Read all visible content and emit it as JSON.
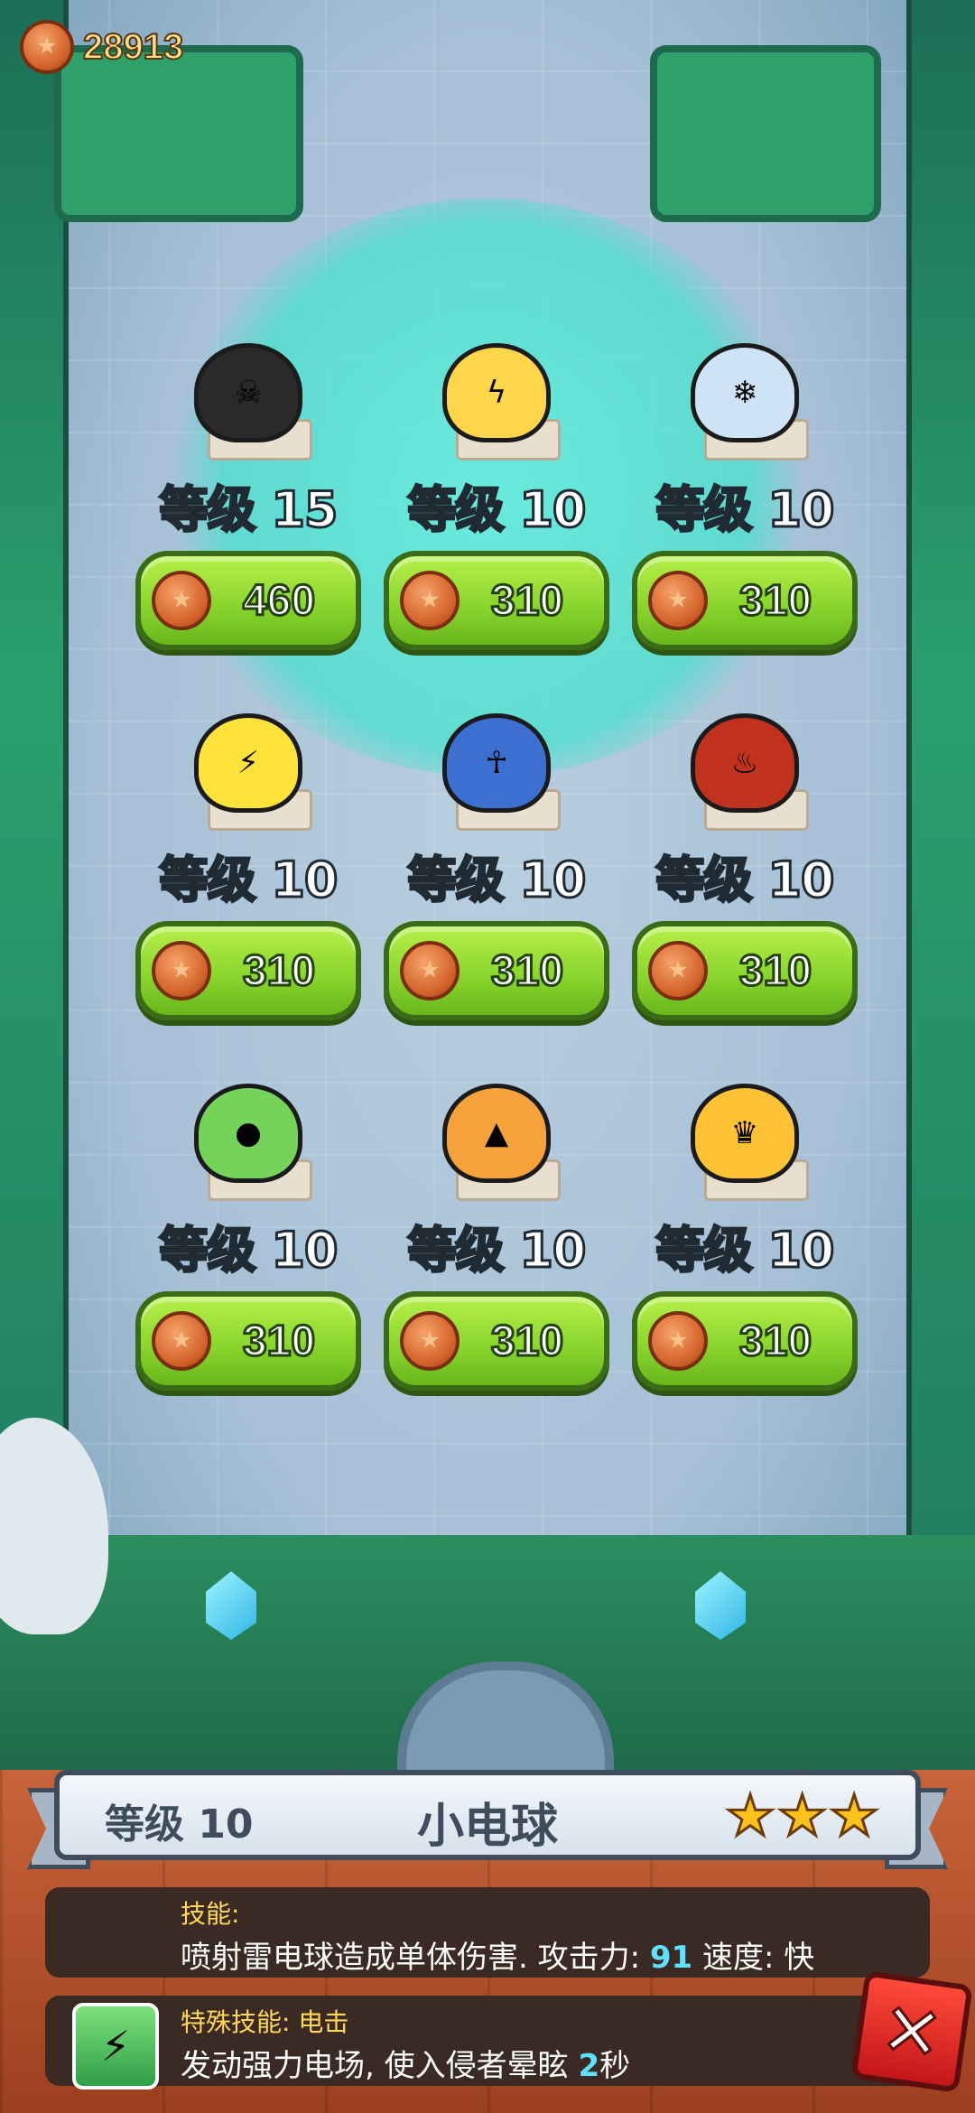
{
  "currency": {
    "icon": "coin-icon",
    "total": "28913"
  },
  "monsters": [
    {
      "name_icon": "hooded-reaper-monster",
      "glyph": "☠",
      "color": "#2a2a2a",
      "level": "等级 15",
      "price": "460"
    },
    {
      "name_icon": "yellow-spark-blob-monster",
      "glyph": "ϟ",
      "color": "#ffd64a",
      "level": "等级 10",
      "price": "310"
    },
    {
      "name_icon": "ice-dragon-monster",
      "glyph": "❄",
      "color": "#cfe3f7",
      "level": "等级 10",
      "price": "310"
    },
    {
      "name_icon": "electric-beast-monster",
      "glyph": "⚡",
      "color": "#ffe23a",
      "level": "等级 10",
      "price": "310"
    },
    {
      "name_icon": "pharaoh-monster",
      "glyph": "☥",
      "color": "#3d6fd0",
      "level": "等级 10",
      "price": "310"
    },
    {
      "name_icon": "fire-demon-monster",
      "glyph": "♨",
      "color": "#c0321e",
      "level": "等级 10",
      "price": "310"
    },
    {
      "name_icon": "green-slime-monster",
      "glyph": "●",
      "color": "#76d35a",
      "level": "等级 10",
      "price": "310"
    },
    {
      "name_icon": "orange-dragon-monster",
      "glyph": "▲",
      "color": "#f6a23a",
      "level": "等级 10",
      "price": "310"
    },
    {
      "name_icon": "king-blob-monster",
      "glyph": "♛",
      "color": "#ffc234",
      "level": "等级 10",
      "price": "310"
    }
  ],
  "detail": {
    "level": "等级 10",
    "name": "小电球",
    "stars": [
      "★",
      "★",
      "★"
    ],
    "skill_heading": "技能:",
    "skill_text_before": "喷射雷电球造成单体伤害. 攻击力: ",
    "skill_attack": "91",
    "skill_text_after": " 速度: 快",
    "special_heading": "特殊技能: 电击",
    "special_text_before": "发动强力电场, 使入侵者晕眩 ",
    "special_seconds": "2",
    "special_text_after": "秒",
    "special_icon": "electric-field-icon",
    "close_glyph": "✕"
  }
}
